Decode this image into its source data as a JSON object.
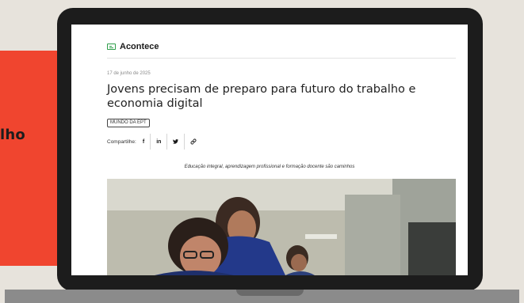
{
  "side_panel": {
    "text": "lho"
  },
  "section": {
    "title": "Acontece",
    "icon": "newspaper-icon"
  },
  "article": {
    "date": "17 de junho de 2025",
    "title": "Jovens precisam de preparo para futuro do trabalho e economia digital",
    "category": "MUNDO DA EPT",
    "share_label": "Compartilhe:",
    "share_buttons": [
      {
        "label": "f",
        "icon": "facebook-icon"
      },
      {
        "label": "in",
        "icon": "linkedin-icon"
      },
      {
        "label": "🐦",
        "icon": "twitter-icon"
      },
      {
        "label": "🔗",
        "icon": "link-icon"
      }
    ],
    "caption": "Educação integral, aprendizagem profissional e formação docente são caminhos"
  },
  "colors": {
    "accent_red": "#f0452f",
    "icon_green": "#2e9e4a",
    "laptop_frame": "#1c1c1c"
  }
}
